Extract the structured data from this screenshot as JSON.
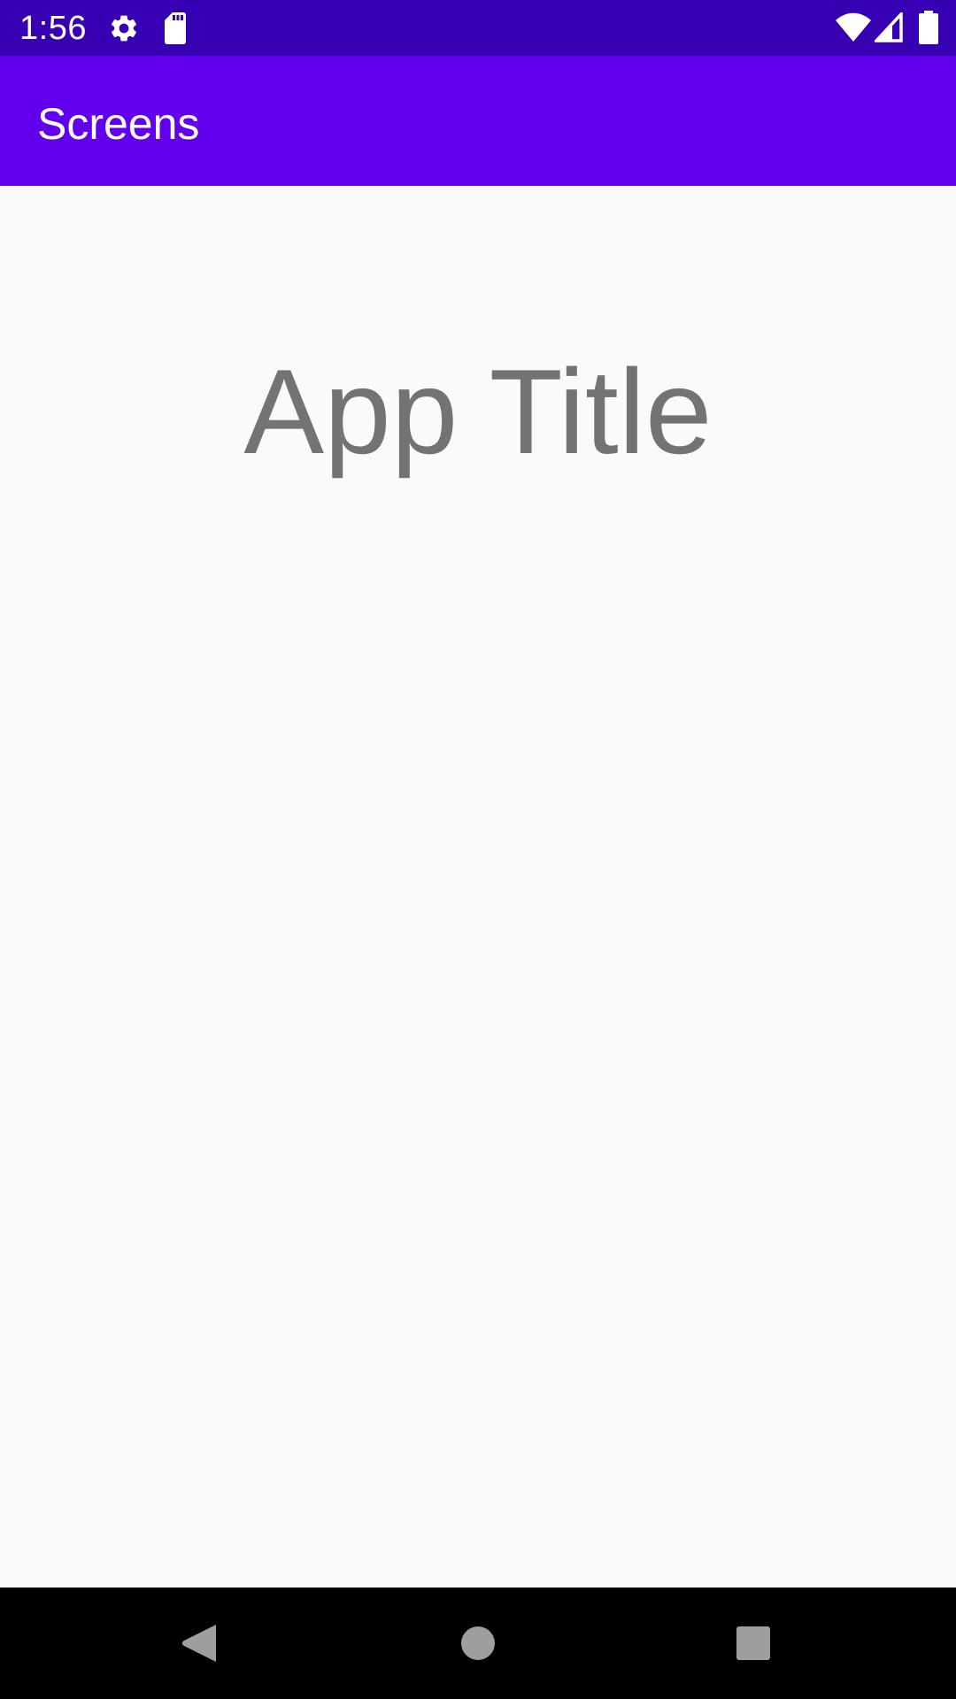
{
  "status_bar": {
    "time": "1:56",
    "icons": [
      "gear-icon",
      "sd-card-icon",
      "wifi-icon",
      "cell-signal-icon",
      "battery-icon"
    ],
    "color": "#3700b3"
  },
  "app_bar": {
    "title": "Screens",
    "color": "#6200ee"
  },
  "main": {
    "app_title": "App Title",
    "text_color": "#737373"
  },
  "nav_bar": {
    "buttons": [
      "back-icon",
      "home-icon",
      "recents-icon"
    ]
  }
}
